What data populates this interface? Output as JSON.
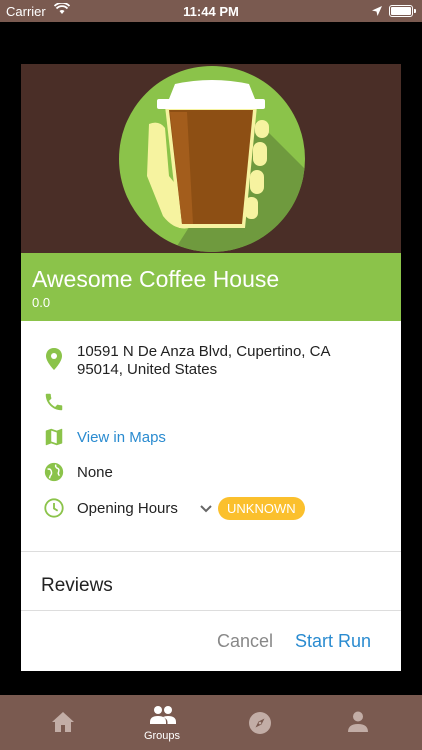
{
  "status_bar": {
    "carrier": "Carrier",
    "time": "11:44 PM"
  },
  "place": {
    "name": "Awesome Coffee House",
    "rating": "0.0",
    "address": [
      "10591 N De Anza Blvd, Cupertino, CA",
      "95014, United States"
    ],
    "phone": "",
    "maps_link": "View in Maps",
    "website": "None",
    "opening_hours_label": "Opening Hours",
    "opening_status": "UNKNOWN"
  },
  "reviews_title": "Reviews",
  "actions": {
    "cancel": "Cancel",
    "start": "Start Run"
  },
  "tab_bar": {
    "items": [
      {
        "icon": "home-icon",
        "label": ""
      },
      {
        "icon": "groups-icon",
        "label": "Groups"
      },
      {
        "icon": "compass-icon",
        "label": ""
      },
      {
        "icon": "person-icon",
        "label": ""
      }
    ]
  },
  "colors": {
    "brand_brown": "#7a5a50",
    "hero_bg": "#4a2e27",
    "accent_green": "#8bc34a",
    "link_blue": "#2a8bd0",
    "badge_yellow": "#fbc02d"
  }
}
